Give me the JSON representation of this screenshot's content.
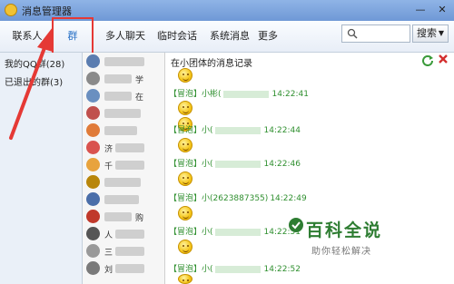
{
  "window": {
    "title": "消息管理器",
    "controls": [
      "—",
      "✕"
    ]
  },
  "toolbar": {
    "tabs": [
      {
        "label": "联系人"
      },
      {
        "label": "群"
      },
      {
        "label": "多人聊天"
      },
      {
        "label": "临时会话"
      },
      {
        "label": "系统消息"
      },
      {
        "label": "更多"
      }
    ],
    "search_placeholder": "",
    "search_button": "搜索"
  },
  "left_panel": {
    "items": [
      "我的QQ群(28)",
      "已退出的群(3)"
    ]
  },
  "groups": [
    {
      "text": ""
    },
    {
      "text": "学"
    },
    {
      "text": "在"
    },
    {
      "text": ""
    },
    {
      "text": ""
    },
    {
      "text": "济"
    },
    {
      "text": "千"
    },
    {
      "text": ""
    },
    {
      "text": ""
    },
    {
      "text": "购"
    },
    {
      "text": "人"
    },
    {
      "text": "三"
    },
    {
      "text": "刘"
    }
  ],
  "main": {
    "title": "在小团体的消息记录",
    "messages": [
      {
        "tag": "【冒泡】",
        "name": "小彬(",
        "time": "14:22:41"
      },
      {
        "tag": "【冒泡】",
        "name": "小(",
        "time": "14:22:44"
      },
      {
        "tag": "【冒泡】",
        "name": "小(",
        "time": "14:22:46"
      },
      {
        "tag": "【冒泡】",
        "name": "小(2623887355)",
        "time": "14:22:49"
      },
      {
        "tag": "【冒泡】",
        "name": "小(",
        "time": "14:22:51"
      },
      {
        "tag": "【冒泡】",
        "name": "小(",
        "time": "14:22:52"
      }
    ]
  },
  "watermark": {
    "big": "百科全说",
    "small": "助你轻松解决"
  },
  "colors": {
    "accent": "#2b72c6",
    "highlight": "#e53935",
    "message_green": "#2f8f2f",
    "watermark_green": "#2e7d32"
  }
}
